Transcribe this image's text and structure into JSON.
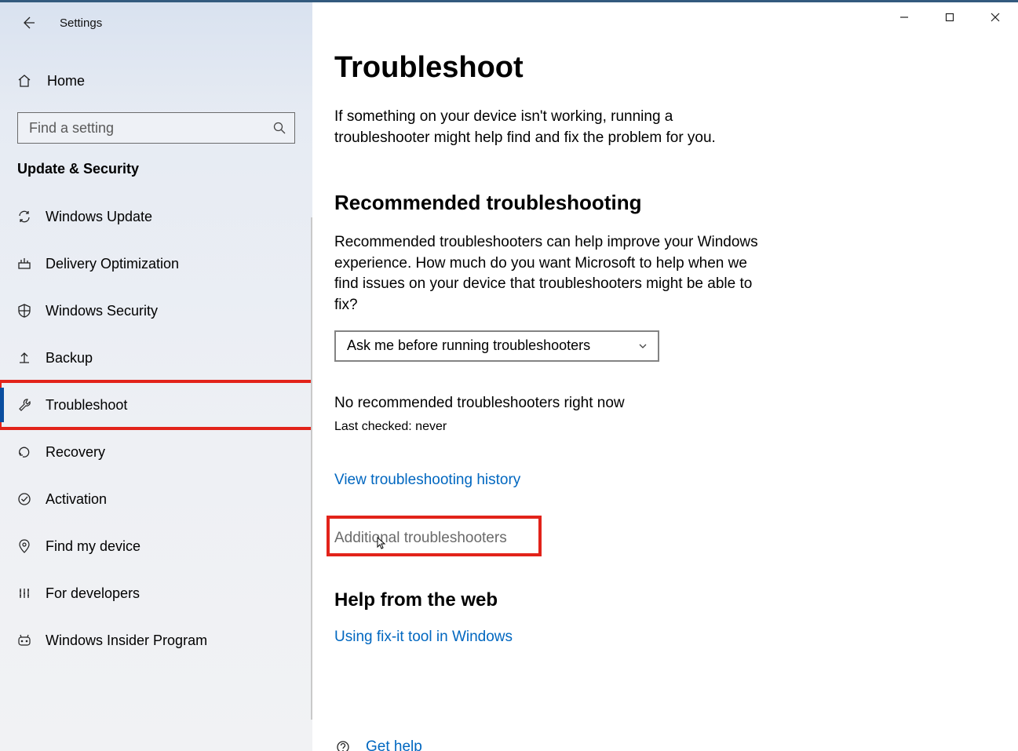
{
  "app_title": "Settings",
  "home_label": "Home",
  "search_placeholder": "Find a setting",
  "category_label": "Update & Security",
  "nav_items": [
    {
      "label": "Windows Update"
    },
    {
      "label": "Delivery Optimization"
    },
    {
      "label": "Windows Security"
    },
    {
      "label": "Backup"
    },
    {
      "label": "Troubleshoot"
    },
    {
      "label": "Recovery"
    },
    {
      "label": "Activation"
    },
    {
      "label": "Find my device"
    },
    {
      "label": "For developers"
    },
    {
      "label": "Windows Insider Program"
    }
  ],
  "main": {
    "title": "Troubleshoot",
    "intro": "If something on your device isn't working, running a troubleshooter might help find and fix the problem for you.",
    "section1_title": "Recommended troubleshooting",
    "section1_desc": "Recommended troubleshooters can help improve your Windows experience. How much do you want Microsoft to help when we find issues on your device that troubleshooters might be able to fix?",
    "dropdown_value": "Ask me before running troubleshooters",
    "status": "No recommended troubleshooters right now",
    "last_checked": "Last checked: never",
    "history_link": "View troubleshooting history",
    "additional_link": "Additional troubleshooters",
    "help_heading": "Help from the web",
    "fixit_link": "Using fix-it tool in Windows",
    "get_help": "Get help"
  }
}
